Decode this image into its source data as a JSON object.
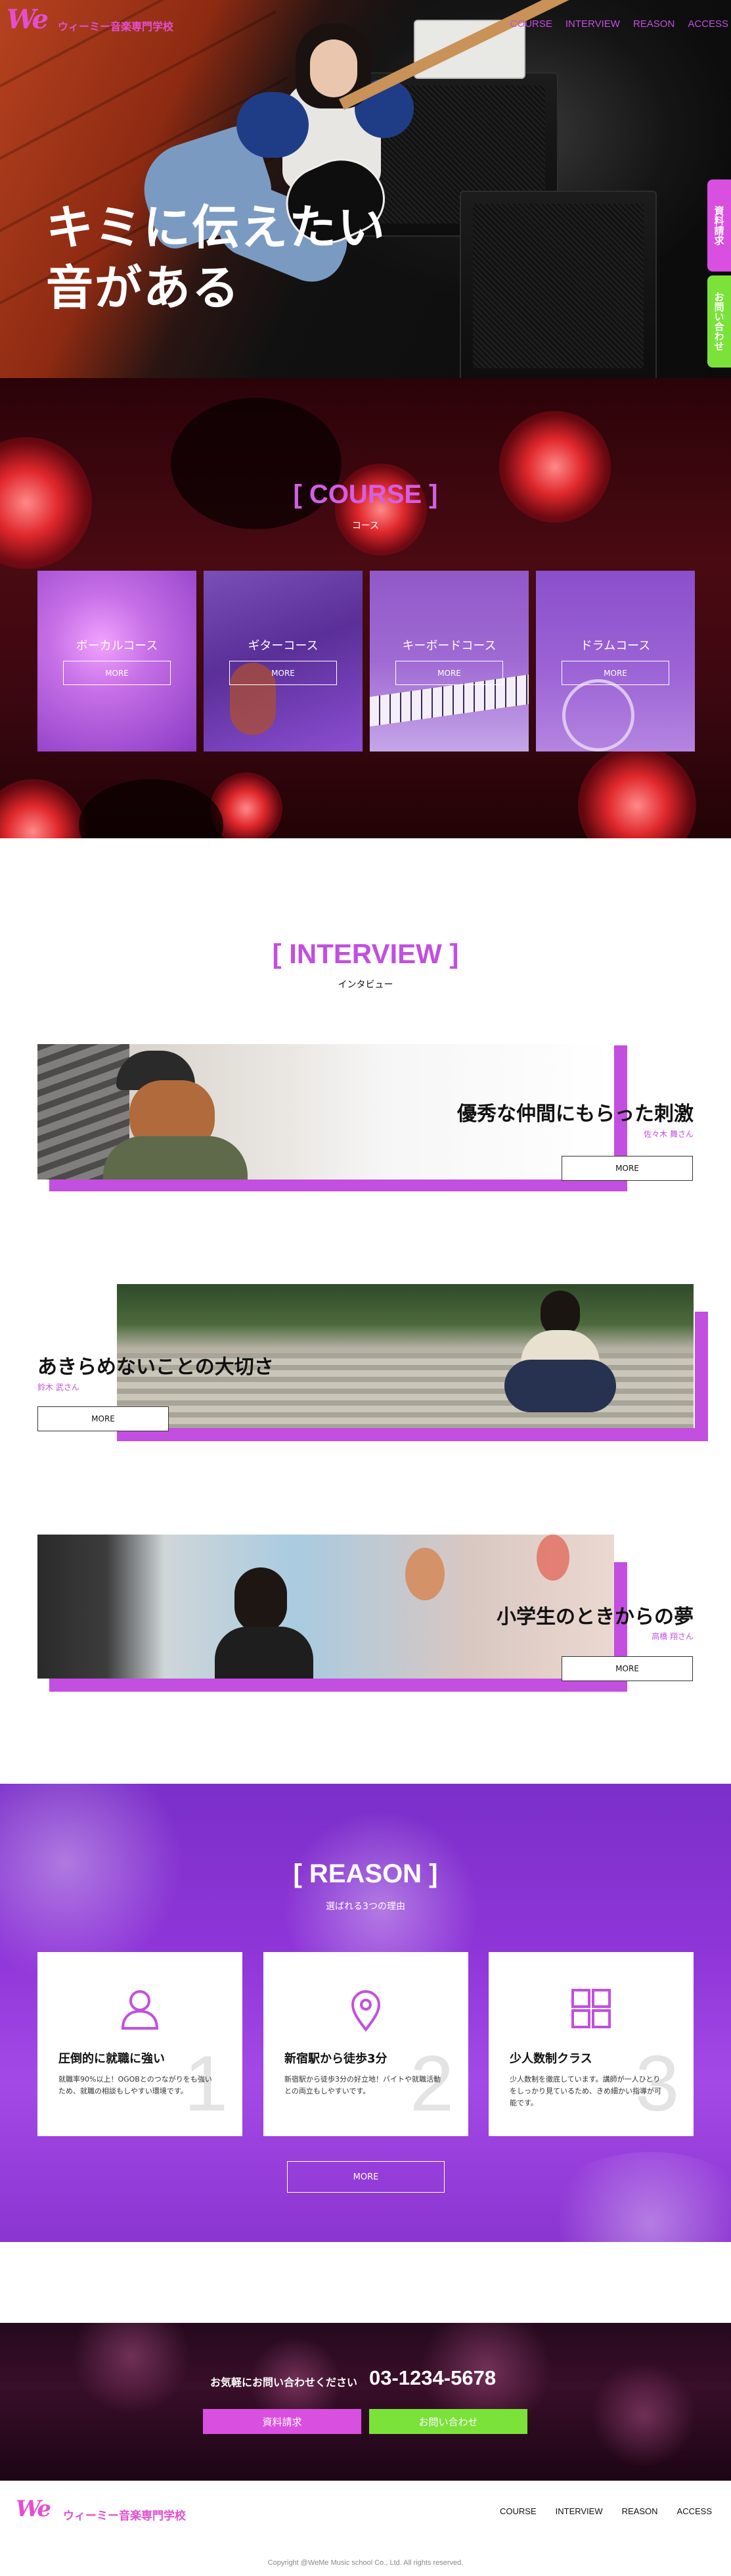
{
  "brand": {
    "mark": "We",
    "name": "ウィーミー音楽専門学校"
  },
  "nav": [
    "COURSE",
    "INTERVIEW",
    "REASON",
    "ACCESS"
  ],
  "hero": {
    "line1": "キミに伝えたい",
    "line2": "音がある"
  },
  "side_tabs": {
    "request": "資料請求",
    "inquiry": "お問い合わせ"
  },
  "course": {
    "title": "[ COURSE ]",
    "subtitle": "コース",
    "cards": [
      {
        "name": "ボーカルコース",
        "more": "MORE"
      },
      {
        "name": "ギターコース",
        "more": "MORE"
      },
      {
        "name": "キーボードコース",
        "more": "MORE"
      },
      {
        "name": "ドラムコース",
        "more": "MORE"
      }
    ]
  },
  "interview": {
    "title": "[ INTERVIEW ]",
    "subtitle": "インタビュー",
    "items": [
      {
        "headline": "優秀な仲間にもらった刺激",
        "name": "佐々木 舞さん",
        "more": "MORE"
      },
      {
        "headline": "あきらめないことの大切さ",
        "name": "鈴木 武さん",
        "more": "MORE"
      },
      {
        "headline": "小学生のときからの夢",
        "name": "高橋 翔さん",
        "more": "MORE"
      }
    ]
  },
  "reason": {
    "title": "[ REASON ]",
    "subtitle": "選ばれる3つの理由",
    "items": [
      {
        "num": "1",
        "icon": "person-icon",
        "title": "圧倒的に就職に強い",
        "body": "就職率90%以上！OGOBとのつながりをも強いため、就職の相談もしやすい環境です。"
      },
      {
        "num": "2",
        "icon": "location-pin-icon",
        "title": "新宿駅から徒歩3分",
        "body": "新宿駅から徒歩3分の好立地！バイトや就職活動との両立もしやすいです。"
      },
      {
        "num": "3",
        "icon": "grid-icon",
        "title": "少人数制クラス",
        "body": "少人数制を徹底しています。講師が一人ひとりをしっかり見ているため、きめ細かい指導が可能です。"
      }
    ],
    "more": "MORE"
  },
  "contact": {
    "label": "お気軽にお問い合わせください",
    "phone": "03-1234-5678",
    "request_button": "資料請求",
    "inquiry_button": "お問い合わせ"
  },
  "footer": {
    "copyright": "Copyright @WeMe Music school Co., Ltd. All rights reserved."
  },
  "colors": {
    "accent": "#c24fe0",
    "logo": "#e34fd0",
    "green": "#7be23a"
  }
}
